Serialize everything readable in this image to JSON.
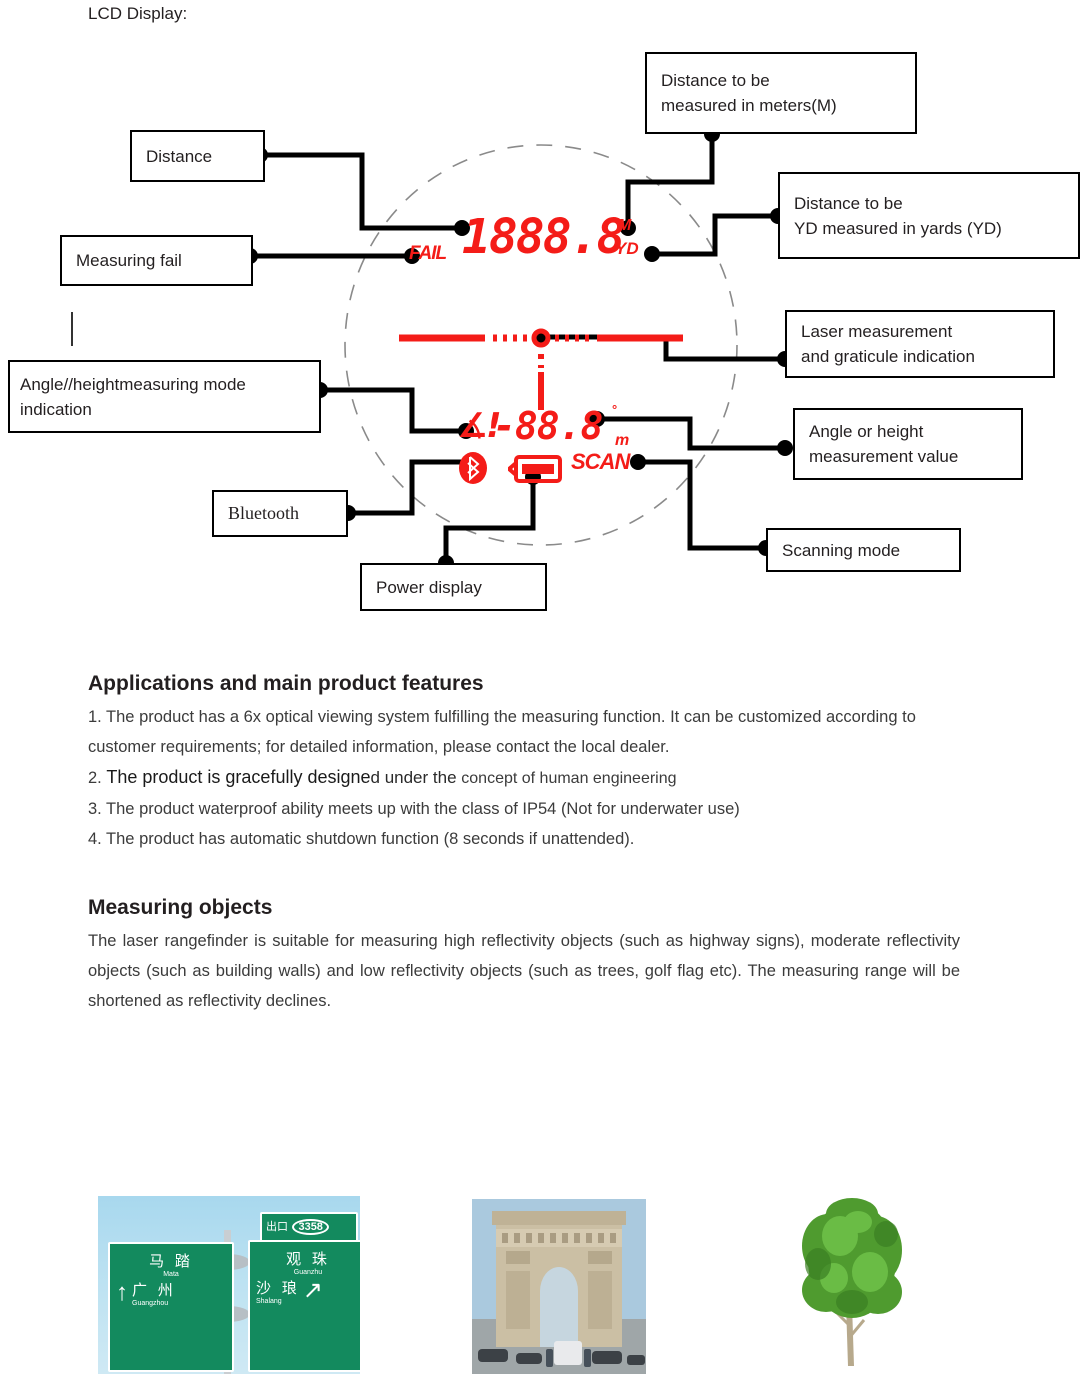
{
  "page": {
    "lcd_heading": "LCD Display:"
  },
  "lcd": {
    "fail_label": "FAIL",
    "main_value": "1888.8",
    "unit_meters": "M",
    "unit_yards": "YD",
    "angle_value": "-88.8",
    "angle_degree_symbol": "°",
    "angle_unit": "m",
    "scan_label": "SCAN",
    "bluetooth_icon": "bluetooth-icon",
    "battery_icon": "battery-icon",
    "angle_mode_icon": "angle-height-icon",
    "graticule_icon": "graticule-crosshair-icon",
    "red": "#f41c18"
  },
  "callouts": [
    {
      "id": "distance",
      "lines": [
        "Distance"
      ]
    },
    {
      "id": "measuring-fail",
      "lines": [
        "Measuring fail"
      ]
    },
    {
      "id": "angle-mode",
      "lines": [
        "Angle//heightmeasuring mode",
        "indication"
      ]
    },
    {
      "id": "bluetooth",
      "lines": [
        "Bluetooth"
      ]
    },
    {
      "id": "power-display",
      "lines": [
        "Power display"
      ]
    },
    {
      "id": "meters",
      "lines": [
        "Distance to be",
        "measured in meters(M)"
      ]
    },
    {
      "id": "yards",
      "lines": [
        "Distance to be",
        "YD measured in yards (YD)"
      ]
    },
    {
      "id": "laser",
      "lines": [
        "Laser measurement",
        "and graticule indication"
      ]
    },
    {
      "id": "angle-value",
      "lines": [
        "Angle or height",
        "measurement value"
      ]
    },
    {
      "id": "scanning",
      "lines": [
        "Scanning mode"
      ]
    }
  ],
  "features": {
    "title": "Applications and main product features",
    "item1": "1. The product has a 6x optical viewing system fulfilling the measuring function. It can be customized according to customer requirements; for detailed information, please contact the local dealer.",
    "item2_num": "2. ",
    "item2_a": "The product is gracefully designe",
    "item2_b": "d under the ",
    "item2_c": "concept of human engineering",
    "item3": "3. The product waterproof ability meets up with the class of IP54 (Not for underwater use)",
    "item4": "4. The product has automatic shutdown function (8 seconds if unattended)."
  },
  "measuring": {
    "title": "Measuring objects",
    "paragraph": "The laser rangefinder is suitable for measuring high reflectivity objects (such as highway signs), moderate reflectivity objects (such as building walls) and low reflectivity objects (such as trees, golf flag etc). The measuring range will be shortened as reflectivity declines."
  },
  "photos": {
    "sign": {
      "name": "highway-sign-photo",
      "exit_label": "出口",
      "exit_number": "3358",
      "left_cn": "马 踏",
      "left_py": "Mata",
      "left_cn2": "广 州",
      "left_py2": "Guangzhou",
      "right_cn": "观 珠",
      "right_py": "Guanzhu",
      "right_cn2": "沙 琅",
      "right_py2": "Shalang"
    },
    "arc": {
      "name": "arc-de-triomphe-photo"
    },
    "tree": {
      "name": "tree-photo"
    }
  }
}
